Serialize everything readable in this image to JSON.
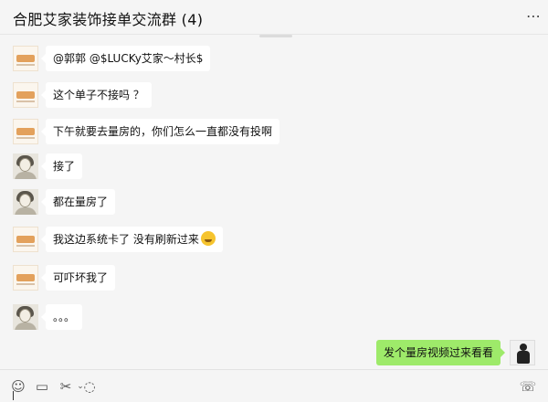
{
  "header": {
    "title": "合肥艾家装饰接单交流群 (4)",
    "more_icon": "more-icon"
  },
  "messages": [
    {
      "avatar": "company-logo",
      "text": "@郭郭 @$LUCKy艾家～村长$"
    },
    {
      "avatar": "company-logo",
      "text": "这个单子不接吗 ？"
    },
    {
      "avatar": "company-logo",
      "text": "下午就要去量房的，你们怎么一直都没有投啊"
    },
    {
      "avatar": "woman-portrait",
      "text": "接了"
    },
    {
      "avatar": "woman-portrait",
      "text": "都在量房了"
    },
    {
      "avatar": "company-logo",
      "text": "我这边系统卡了  没有刷新过来",
      "emoji": "crying-laughing-emoji"
    },
    {
      "avatar": "company-logo",
      "text": "可吓坏我了"
    },
    {
      "avatar": "woman-portrait",
      "text": "。。。"
    }
  ],
  "outgoing": {
    "text": "发个量房视频过来看看",
    "avatar": "user-photo",
    "bubble_color": "#9eea6a"
  },
  "toolbar": {
    "icons": [
      "emoji-icon",
      "folder-icon",
      "scissors-icon",
      "chat-history-icon",
      "video-call-icon"
    ]
  },
  "colors": {
    "background": "#f5f5f5",
    "incoming_bubble": "#ffffff"
  }
}
